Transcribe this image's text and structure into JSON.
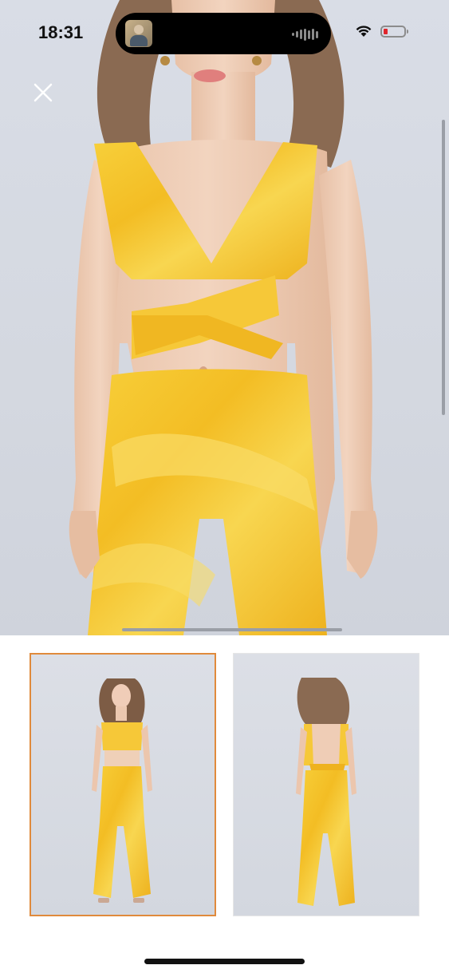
{
  "status_bar": {
    "time": "18:31",
    "icons": [
      "now-playing-thumbnail",
      "audio-waveform-icon",
      "wifi-icon",
      "battery-low-icon"
    ],
    "battery_level": 0.1,
    "battery_color": "#e0262c"
  },
  "viewer": {
    "close_icon": "close-icon",
    "main_image_description_icon": "product-photo",
    "garment_color": "#f4c430"
  },
  "thumbnails": {
    "items": [
      {
        "view": "front",
        "selected": true
      },
      {
        "view": "back",
        "selected": false
      }
    ],
    "selected_border_color": "#e08a3c"
  }
}
